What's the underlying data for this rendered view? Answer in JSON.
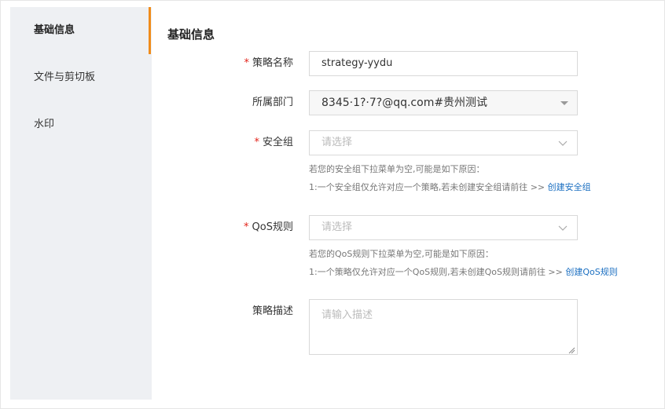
{
  "sidebar": {
    "items": [
      {
        "label": "基础信息"
      },
      {
        "label": "文件与剪切板"
      },
      {
        "label": "水印"
      }
    ]
  },
  "main": {
    "title": "基础信息",
    "fields": {
      "name": {
        "required_mark": "*",
        "label": "策略名称",
        "value": "strategy-yydu"
      },
      "department": {
        "label": "所属部门",
        "value": "8345·1?·7?@qq.com#贵州测试"
      },
      "security_group": {
        "required_mark": "*",
        "label": "安全组",
        "placeholder": "请选择",
        "hint_line1": "若您的安全组下拉菜单为空,可能是如下原因：",
        "hint_line2": "1:一个安全组仅允许对应一个策略,若未创建安全组请前往 >>",
        "hint_link": "创建安全组"
      },
      "qos": {
        "required_mark": "*",
        "label": "QoS规则",
        "placeholder": "请选择",
        "hint_line1": "若您的QoS规则下拉菜单为空,可能是如下原因：",
        "hint_line2": "1:一个策略仅允许对应一个QoS规则,若未创建QoS规则请前往 >>",
        "hint_link": "创建QoS规则"
      },
      "description": {
        "label": "策略描述",
        "placeholder": "请输入描述"
      }
    }
  },
  "colors": {
    "accent": "#f08c1b",
    "sidebar_bg": "#eef0f3",
    "link": "#1b6fc1",
    "required": "#e2231a"
  }
}
